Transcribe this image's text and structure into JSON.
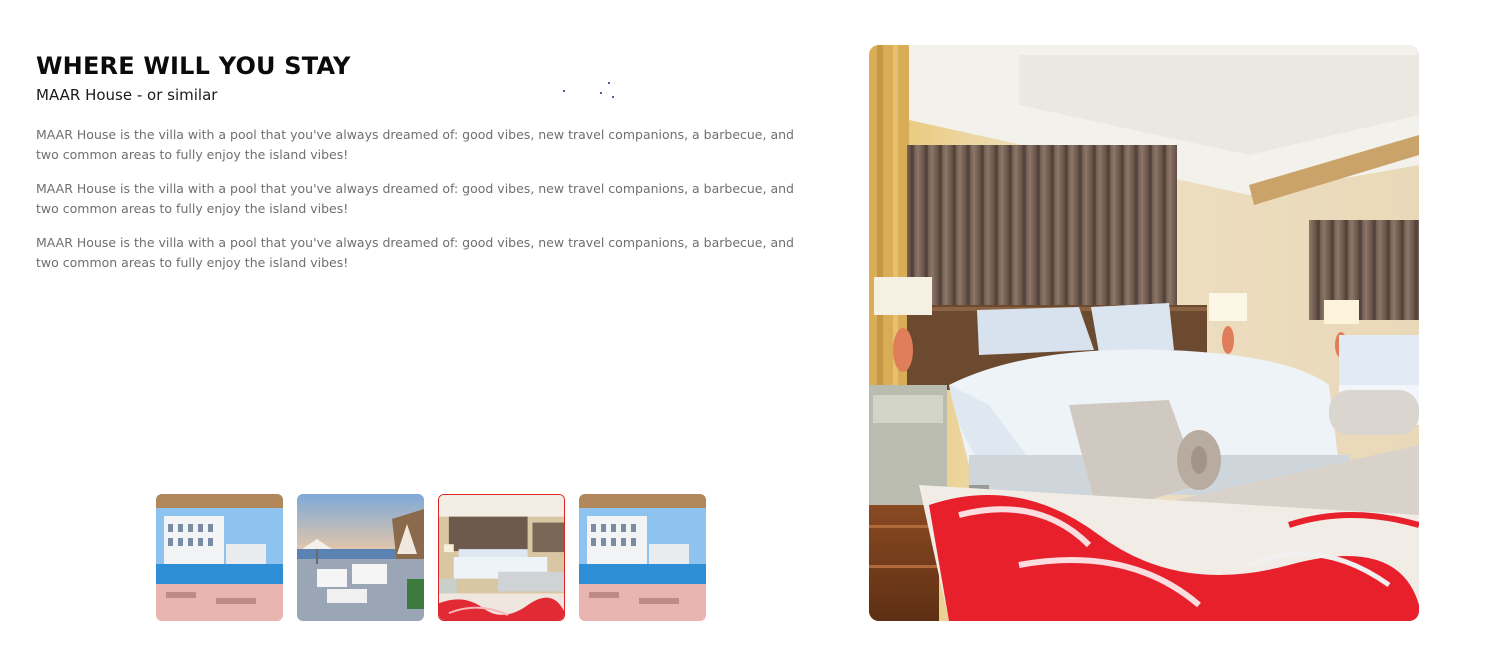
{
  "section": {
    "title": "WHERE WILL YOU STAY",
    "subtitle": "MAAR House - or similar",
    "paragraphs": [
      "MAAR House is the villa with a pool that you've always dreamed of: good vibes, new travel companions, a barbecue, and two common areas to fully enjoy the island vibes!",
      "MAAR House is the villa with a pool that you've always dreamed of: good vibes, new travel companions, a barbecue, and two common areas to fully enjoy the island vibes!",
      "MAAR House is the villa with a pool that you've always dreamed of: good vibes, new travel companions, a barbecue, and two common areas to fully enjoy the island vibes!"
    ]
  },
  "gallery": {
    "selected_index": 2,
    "thumbnails": [
      {
        "subject": "hotel-pool-exterior"
      },
      {
        "subject": "seaside-terrace"
      },
      {
        "subject": "hotel-bedroom"
      },
      {
        "subject": "hotel-pool-exterior"
      }
    ],
    "main_image": {
      "subject": "hotel-bedroom"
    }
  },
  "colors": {
    "title": "#0b0b0b",
    "body_text": "#6f6f6f",
    "active_thumb_border": "#e02424"
  }
}
